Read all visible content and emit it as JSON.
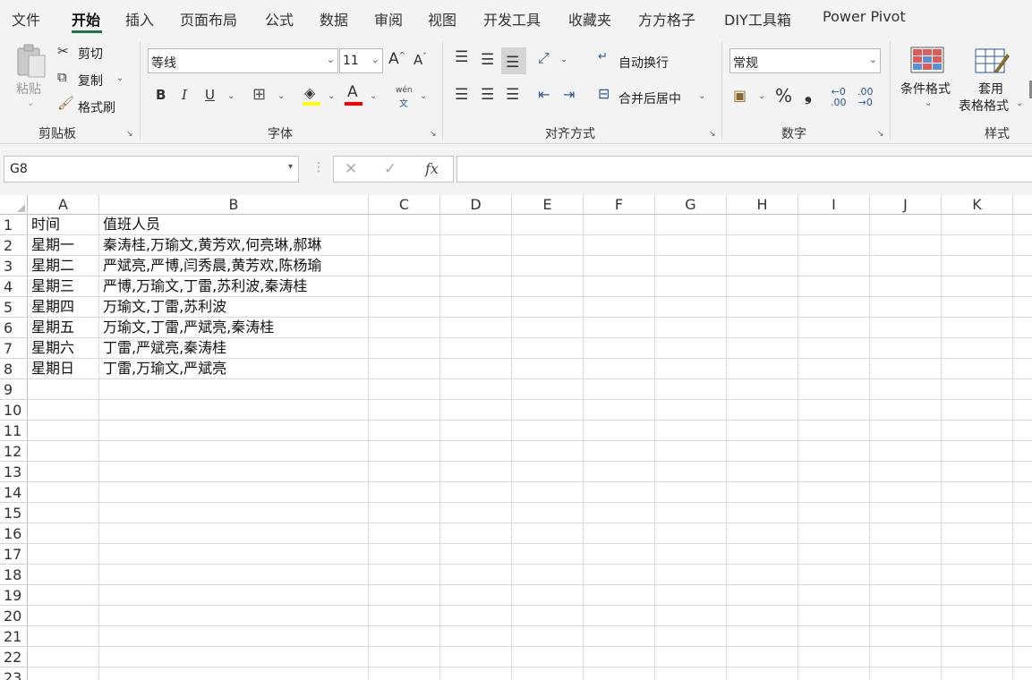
{
  "tabs": [
    "文件",
    "开始",
    "插入",
    "页面布局",
    "公式",
    "数据",
    "审阅",
    "视图",
    "开发工具",
    "收藏夹",
    "方方格子",
    "DIY工具箱",
    "Power Pivot"
  ],
  "ribbon": {
    "clipboard": {
      "paste": "粘贴",
      "cut": "剪切",
      "copy": "复制",
      "format_painter": "格式刷",
      "group": "剪贴板"
    },
    "font": {
      "name": "等线",
      "size": "11",
      "grow": "A^",
      "shrink": "Aˇ",
      "bold": "B",
      "italic": "I",
      "underline": "U",
      "font_color_glyph": "A",
      "phonetic_top": "wén",
      "phonetic_bottom": "文",
      "group": "字体"
    },
    "alignment": {
      "wrap": "自动换行",
      "merge": "合并后居中",
      "group": "对齐方式"
    },
    "number": {
      "format": "常规",
      "percent": "%",
      "comma": "❟",
      "group": "数字"
    },
    "styles": {
      "conditional": "条件格式",
      "table_top": "套用",
      "table_bottom": "表格格式",
      "group": "样式"
    }
  },
  "formula_bar": {
    "name_box": "G8",
    "fx": "fx",
    "content": ""
  },
  "sheet": {
    "columns": [
      "A",
      "B",
      "C",
      "D",
      "E",
      "F",
      "G",
      "H",
      "I",
      "J",
      "K"
    ],
    "rows": [
      "1",
      "2",
      "3",
      "4",
      "5",
      "6",
      "7",
      "8",
      "9",
      "10",
      "11",
      "12",
      "13",
      "14",
      "15",
      "16",
      "17",
      "18",
      "19",
      "20",
      "21",
      "22",
      "23"
    ],
    "cells": [
      [
        "时间",
        "值班人员"
      ],
      [
        "星期一",
        "秦涛桂,万瑜文,黄芳欢,何亮琳,郝琳"
      ],
      [
        "星期二",
        "严斌亮,严博,闫秀晨,黄芳欢,陈杨瑜"
      ],
      [
        "星期三",
        "严博,万瑜文,丁雷,苏利波,秦涛桂"
      ],
      [
        "星期四",
        "万瑜文,丁雷,苏利波"
      ],
      [
        "星期五",
        "万瑜文,丁雷,严斌亮,秦涛桂"
      ],
      [
        "星期六",
        "丁雷,严斌亮,秦涛桂"
      ],
      [
        "星期日",
        "丁雷,万瑜文,严斌亮"
      ]
    ]
  },
  "colors": {
    "accent": "#217346",
    "highlight": "#ffff00",
    "font_red": "#ff0000"
  }
}
